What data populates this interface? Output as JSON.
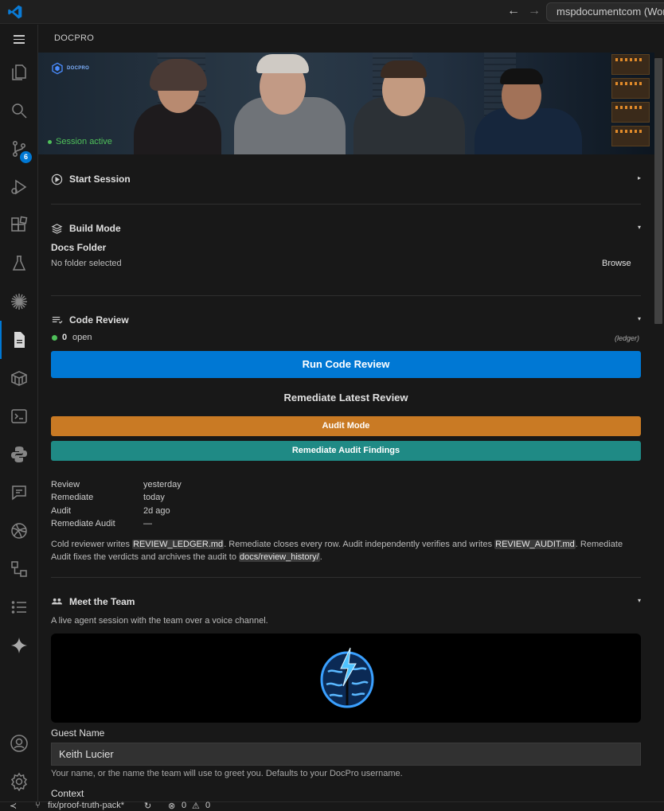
{
  "titlebar": {
    "back_arrow": "←",
    "forward_arrow": "→",
    "command_center": "mspdocumentcom (Works"
  },
  "activitybar": {
    "items": [
      "explorer-icon",
      "search-icon",
      "source-control-icon",
      "run-debug-icon",
      "extensions-icon",
      "testing-icon",
      "sparkle-burst-icon",
      "docpro-icon",
      "package-icon",
      "terminal-icon",
      "python-icon",
      "chat-icon",
      "ball-icon",
      "flow-icon",
      "checklist-icon",
      "copilot-icon",
      "account-icon",
      "settings-icon"
    ],
    "source_control_badge": "6"
  },
  "panel": {
    "title": "DOCPRO"
  },
  "hero": {
    "logo_text": "DOCPRO",
    "session_status": "Session active"
  },
  "start_session": {
    "title": "Start Session",
    "caret": "▸"
  },
  "build_mode": {
    "title": "Build Mode",
    "caret": "▾",
    "docs_folder_label": "Docs Folder",
    "docs_folder_value": "No folder selected",
    "browse_label": "Browse"
  },
  "code_review": {
    "title": "Code Review",
    "caret": "▾",
    "open_count": "0",
    "open_label": "open",
    "ledger_tag": "(ledger)",
    "run_button": "Run Code Review",
    "remediate_latest": "Remediate Latest Review",
    "audit_button": "Audit Mode",
    "remediate_audit_button": "Remediate Audit Findings",
    "stats": [
      {
        "key": "Review",
        "value": "yesterday"
      },
      {
        "key": "Remediate",
        "value": "today"
      },
      {
        "key": "Audit",
        "value": "2d ago"
      },
      {
        "key": "Remediate Audit",
        "value": "—"
      }
    ],
    "desc_1": "Cold reviewer writes ",
    "desc_code_1": "REVIEW_LEDGER.md",
    "desc_2": ". Remediate closes every row. Audit independently verifies and writes ",
    "desc_code_2": "REVIEW_AUDIT.md",
    "desc_3": ". Remediate Audit fixes the verdicts and archives the audit to ",
    "desc_code_3": "docs/review_history/",
    "desc_4": "."
  },
  "team": {
    "title": "Meet the Team",
    "caret": "▾",
    "subtitle": "A live agent session with the team over a voice channel.",
    "guest_name_label": "Guest Name",
    "guest_name_value": "Keith Lucier",
    "guest_name_help": "Your name, or the name the team will use to greet you. Defaults to your DocPro username.",
    "context_label": "Context"
  },
  "statusbar": {
    "remote": "≺",
    "branch": "fix/proof-truth-pack*",
    "errors": "0",
    "warnings": "0"
  },
  "colors": {
    "accent_blue": "#0078d4",
    "audit_orange": "#c97a24",
    "remediate_teal": "#1f8a85",
    "status_green": "#4fc05a"
  }
}
